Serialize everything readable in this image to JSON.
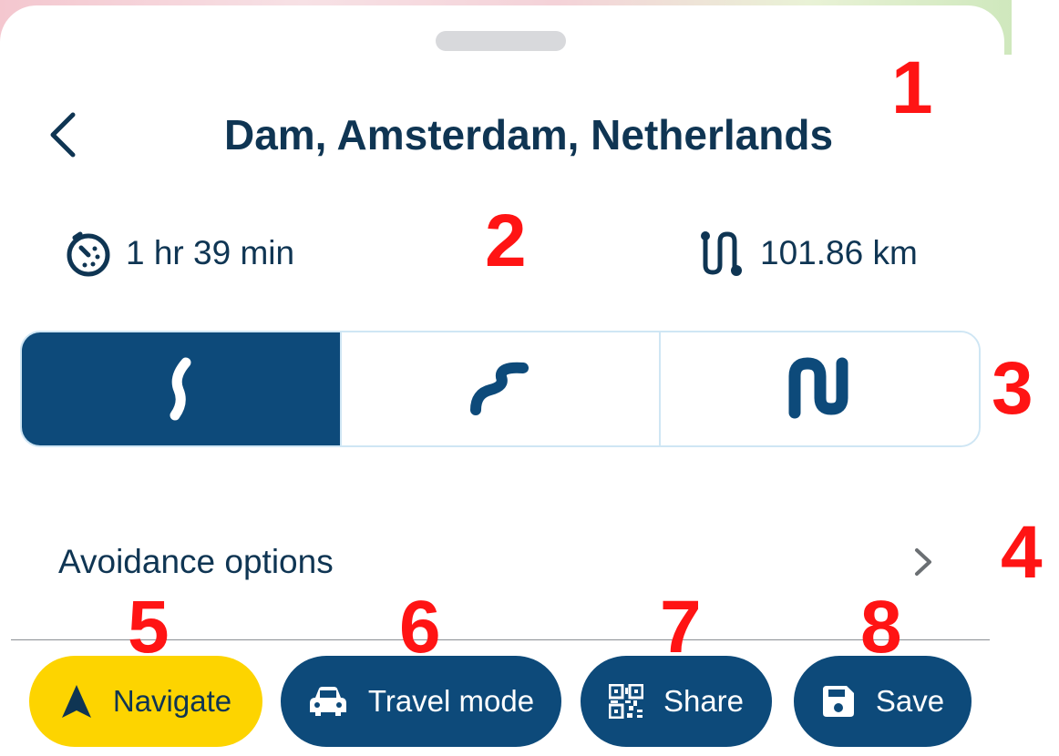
{
  "header": {
    "title": "Dam, Amsterdam, Netherlands"
  },
  "stats": {
    "duration": "1 hr 39 min",
    "distance": "101.86 km"
  },
  "route_options": [
    {
      "icon": "route-gentle-curve-icon",
      "selected": true
    },
    {
      "icon": "route-winding-icon",
      "selected": false
    },
    {
      "icon": "route-hairpin-icon",
      "selected": false
    }
  ],
  "avoidance": {
    "label": "Avoidance options"
  },
  "actions": {
    "navigate_label": "Navigate",
    "travel_mode_label": "Travel mode",
    "share_label": "Share",
    "save_label": "Save"
  },
  "markers": [
    "1",
    "2",
    "3",
    "4",
    "5",
    "6",
    "7",
    "8"
  ],
  "colors": {
    "primary": "#0d4a7a",
    "text": "#0f3553",
    "navigate_bg": "#fdd400",
    "marker": "#ff1414"
  }
}
